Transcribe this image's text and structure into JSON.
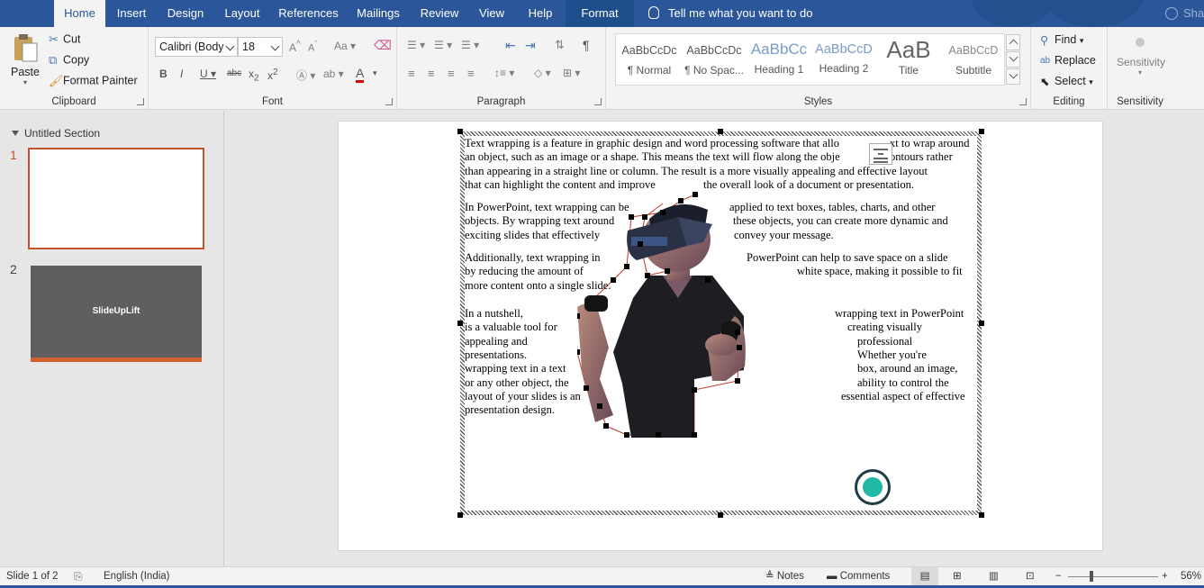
{
  "tabs": [
    "Home",
    "Insert",
    "Design",
    "Layout",
    "References",
    "Mailings",
    "Review",
    "View",
    "Help",
    "Format"
  ],
  "tell_me": "Tell me what you want to do",
  "share": "Shar",
  "clipboard": {
    "paste": "Paste",
    "cut": "Cut",
    "copy": "Copy",
    "format_painter": "Format Painter",
    "label": "Clipboard"
  },
  "font": {
    "name": "Calibri (Body",
    "size": "18",
    "change_case": "Aa",
    "label": "Font"
  },
  "paragraph": {
    "label": "Paragraph"
  },
  "styles": {
    "label": "Styles",
    "items": [
      {
        "sample": "AaBbCcDc",
        "name": "¶ Normal"
      },
      {
        "sample": "AaBbCcDc",
        "name": "¶ No Spac..."
      },
      {
        "sample": "AaBbCc",
        "name": "Heading 1"
      },
      {
        "sample": "AaBbCcD",
        "name": "Heading 2"
      },
      {
        "sample": "AaB",
        "name": "Title"
      },
      {
        "sample": "AaBbCcD",
        "name": "Subtitle"
      }
    ]
  },
  "editing": {
    "find": "Find",
    "replace": "Replace",
    "select": "Select",
    "label": "Editing"
  },
  "sensitivity": {
    "button": "Sensitivity",
    "label": "Sensitivity"
  },
  "slides_pane": {
    "section": "Untitled Section",
    "slides": [
      {
        "number": "1",
        "text": ""
      },
      {
        "number": "2",
        "text": "SlideUpLift"
      }
    ]
  },
  "document_lines": [
    "Text wrapping is a feature in graphic design and word processing software that allo",
    "xt to wrap around",
    "an object, such as an image or a shape. This means the text will flow along the obje",
    "ontours rather",
    "than appearing in a straight line or column. The result is a more visually appealing and effective layout",
    "that can highlight the content and improve",
    "the overall look of a document or presentation.",
    "In PowerPoint, text wrapping can be",
    "applied to text boxes, tables, charts, and other",
    "objects. By wrapping text around",
    "these objects, you can create more dynamic and",
    "exciting slides that effectively",
    "convey your message.",
    "Additionally, text wrapping in",
    "PowerPoint can help to save space on a slide",
    "by reducing the amount of",
    "white space, making it possible to fit",
    "more content onto a single slide.",
    "In a nutshell,",
    "wrapping text in PowerPoint",
    "is a valuable tool for",
    "creating visually",
    "appealing and",
    "professional",
    "presentations.",
    "Whether you're",
    "wrapping text in a text",
    "box, around an image,",
    "or any other object, the",
    "ability to control the",
    "layout of your slides is an",
    "essential aspect of effective",
    "presentation design."
  ],
  "status": {
    "slide": "Slide 1 of 2",
    "language": "English (India)",
    "notes": "Notes",
    "comments": "Comments",
    "zoom_minus": "−",
    "zoom_plus": "+",
    "zoom": "56%"
  }
}
